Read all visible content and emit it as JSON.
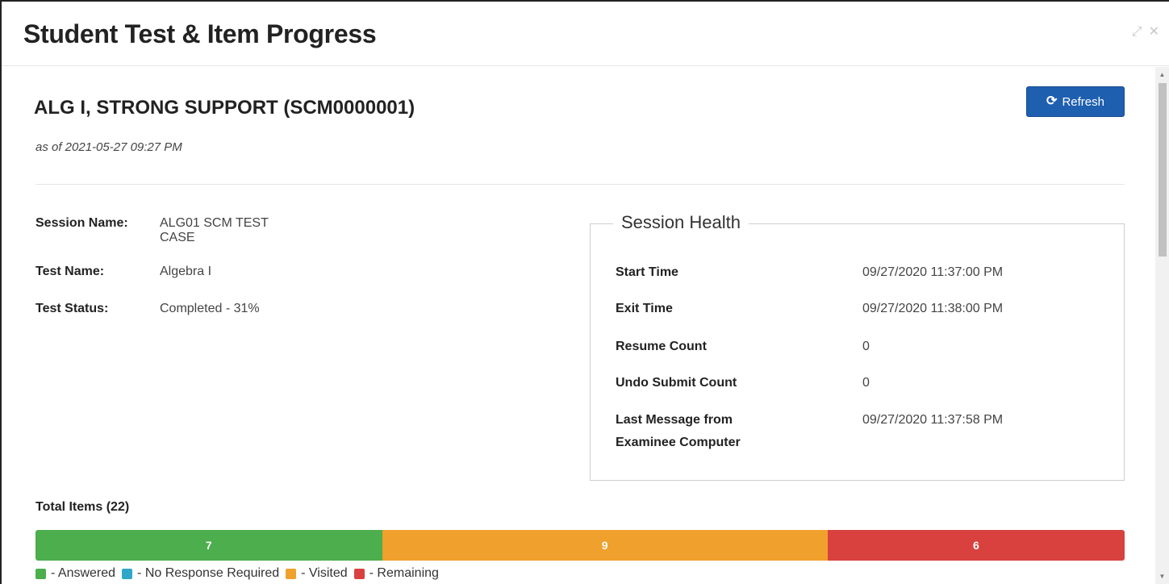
{
  "dialog": {
    "title": "Student Test & Item Progress",
    "expand_icon": "expand-icon",
    "close_icon": "close-icon"
  },
  "test": {
    "heading": "ALG I, STRONG SUPPORT (SCM0000001)",
    "as_of": "as of 2021-05-27 09:27 PM",
    "refresh_label": "Refresh",
    "refresh_icon": "refresh-icon"
  },
  "info": {
    "session_name_label": "Session Name:",
    "session_name_line1": "ALG01 SCM TEST",
    "session_name_line2": "CASE",
    "test_name_label": "Test Name:",
    "test_name": "Algebra I",
    "test_status_label": "Test Status:",
    "test_status": "Completed - 31%"
  },
  "health": {
    "title": "Session Health",
    "rows": [
      {
        "label": "Start Time",
        "value": "09/27/2020 11:37:00 PM"
      },
      {
        "label": "Exit Time",
        "value": "09/27/2020 11:38:00 PM"
      },
      {
        "label": "Resume Count",
        "value": "0"
      },
      {
        "label": "Undo Submit Count",
        "value": "0"
      },
      {
        "label": "Last Message from",
        "label2": "Examinee Computer",
        "value": "09/27/2020 11:37:58 PM"
      }
    ]
  },
  "progress": {
    "total_label": "Total Items (22)",
    "total": 22,
    "segments": [
      {
        "name": "Answered",
        "count": 7,
        "label": "7",
        "color": "#4cae4c"
      },
      {
        "name": "Visited",
        "count": 9,
        "label": "9",
        "color": "#f0a02c"
      },
      {
        "name": "Remaining",
        "count": 6,
        "label": "6",
        "color": "#d9413e"
      }
    ],
    "legend": [
      {
        "label": "- Answered",
        "color": "#4cae4c"
      },
      {
        "label": "- No Response Required",
        "color": "#2fa7c9"
      },
      {
        "label": "- Visited",
        "color": "#f0a02c"
      },
      {
        "label": "- Remaining",
        "color": "#d9413e"
      }
    ]
  }
}
